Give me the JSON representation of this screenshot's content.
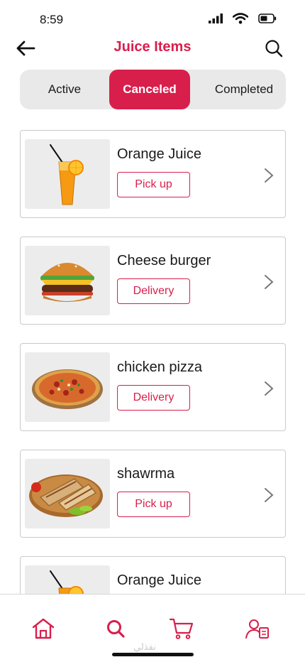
{
  "status_bar": {
    "time": "8:59",
    "icons": [
      "signal-icon",
      "wifi-icon",
      "battery-icon"
    ]
  },
  "header": {
    "title": "Juice Items",
    "back_icon": "arrow-left-icon",
    "search_icon": "search-icon"
  },
  "tabs": [
    {
      "label": "Active",
      "selected": false
    },
    {
      "label": "Canceled",
      "selected": true
    },
    {
      "label": "Completed",
      "selected": false
    }
  ],
  "orders": [
    {
      "name": "Orange Juice",
      "method": "Pick up",
      "image": "orange-juice-icon"
    },
    {
      "name": "Cheese burger",
      "method": "Delivery",
      "image": "burger-icon"
    },
    {
      "name": "chicken pizza",
      "method": "Delivery",
      "image": "pizza-icon"
    },
    {
      "name": "shawrma",
      "method": "Pick up",
      "image": "shawarma-icon"
    },
    {
      "name": "Orange Juice",
      "method": "",
      "image": "orange-juice-icon"
    }
  ],
  "bottom_nav": [
    {
      "icon": "home-icon"
    },
    {
      "icon": "search-icon"
    },
    {
      "icon": "cart-icon"
    },
    {
      "icon": "profile-icon"
    }
  ],
  "watermark": "نفذلي",
  "colors": {
    "accent": "#d81f4c",
    "tab_bg": "#e9e9e9",
    "thumb_bg": "#ececec",
    "border": "#c9c9c9"
  }
}
